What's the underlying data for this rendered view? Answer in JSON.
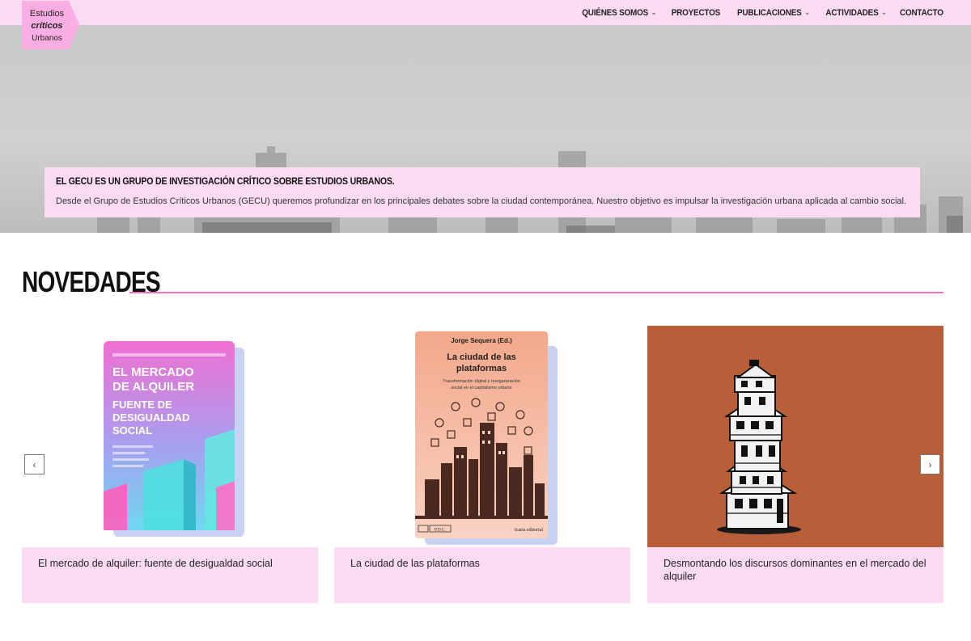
{
  "logo": {
    "line1": "Estudios",
    "line2": "críticos",
    "line3": "Urbanos",
    "color": "#fbaee4"
  },
  "nav": [
    {
      "label": "QUIÉNES SOMOS",
      "has_dropdown": true
    },
    {
      "label": "PROYECTOS",
      "has_dropdown": false
    },
    {
      "label": "PUBLICACIONES",
      "has_dropdown": true
    },
    {
      "label": "ACTIVIDADES",
      "has_dropdown": true
    },
    {
      "label": "CONTACTO",
      "has_dropdown": false
    }
  ],
  "hero": {
    "title": "EL GECU ES UN GRUPO DE INVESTIGACIÓN CRÍTICO SOBRE ESTUDIOS URBANOS.",
    "description": "Desde el Grupo de Estudios Críticos Urbanos (GECU) queremos profundizar en los principales debates sobre la ciudad contemporánea. Nuestro objetivo es impulsar la investigación urbana aplicada al cambio social."
  },
  "section": {
    "title": "NOVEDADES",
    "accent": "#f274c9"
  },
  "carousel": {
    "prev_icon": "‹",
    "next_icon": "›",
    "items": [
      {
        "caption": "El mercado de alquiler: fuente de desigualdad social",
        "cover": {
          "title_lines": [
            "EL MERCADO",
            "DE ALQUILER"
          ],
          "subtitle_lines": [
            "FUENTE DE",
            "DESIGUALDAD",
            "SOCIAL"
          ]
        }
      },
      {
        "caption": "La ciudad de las plataformas",
        "cover": {
          "editor": "Jorge Sequera (Ed.)",
          "title_lines": [
            "La ciudad de las",
            "plataformas"
          ],
          "subtitle_lines": [
            "Transformación digital y reorganización",
            "social en el capitalismo urbano"
          ],
          "series": "P.D.C.",
          "publisher": "Icaria editorial"
        }
      },
      {
        "caption": "Desmontando los discursos dominantes en el mercado del alquiler",
        "cover": {}
      }
    ]
  },
  "colors": {
    "pink_light": "#fddbf2",
    "pink_accent": "#f274c9",
    "card3_bg": "#b85f3a"
  }
}
